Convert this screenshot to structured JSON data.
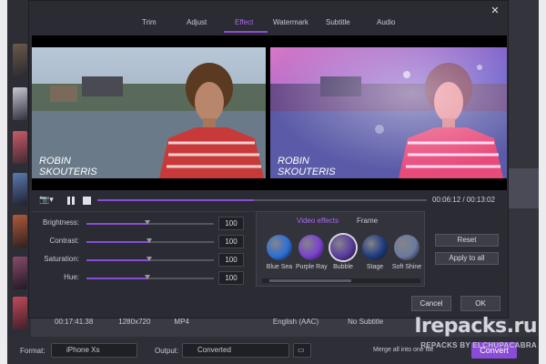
{
  "colors": {
    "accent": "#8a4cd6",
    "dialog_bg": "#2b2b33",
    "panel_bg": "#33333c"
  },
  "dialog": {
    "tabs": [
      {
        "label": "Trim"
      },
      {
        "label": "Adjust"
      },
      {
        "label": "Effect"
      },
      {
        "label": "Watermark"
      },
      {
        "label": "Subtitle"
      },
      {
        "label": "Audio"
      }
    ],
    "active_tab": "Effect",
    "close_icon": "close-icon"
  },
  "preview": {
    "left_caption": "ROBIN\nSKOUTERIS",
    "right_caption": "ROBIN\nSKOUTERIS"
  },
  "playback": {
    "timecode": "00:06:12 / 00:13:02",
    "progress": 0.476
  },
  "adjust": [
    {
      "label": "Brightness:",
      "value": "100",
      "level": 0.48
    },
    {
      "label": "Contrast:",
      "value": "100",
      "level": 0.49
    },
    {
      "label": "Saturation:",
      "value": "100",
      "level": 0.49
    },
    {
      "label": "Hue:",
      "value": "100",
      "level": 0.48
    }
  ],
  "effects_panel": {
    "tabs": [
      {
        "label": "Video effects"
      },
      {
        "label": "Frame"
      }
    ],
    "effects": [
      {
        "label": "Blue Sea",
        "color": "#2a6fd6"
      },
      {
        "label": "Purple Ray",
        "color": "#7a3fcf"
      },
      {
        "label": "Bubble",
        "color": "#5a3aa0"
      },
      {
        "label": "Stage",
        "color": "#1e3a80"
      },
      {
        "label": "Soft Shine",
        "color": "#6a7aa0"
      }
    ],
    "selected": "Bubble"
  },
  "right_buttons": {
    "reset": "Reset",
    "apply_all": "Apply to all"
  },
  "dialog_buttons": {
    "cancel": "Cancel",
    "ok": "OK"
  },
  "background": {
    "duration": "00:17:41.38",
    "resolution": "1280x720",
    "format": "MP4",
    "audio": "English (AAC)",
    "subtitle": "No Subtitle",
    "format_label": "Format:",
    "format_value": "iPhone Xs",
    "output_label": "Output:",
    "output_value": "Converted",
    "merge_label": "Merge all into one file",
    "convert": "Convert"
  },
  "watermark": {
    "main": "Irepacks.ru",
    "sub": "REPACKS BY ELCHUPACABRA"
  }
}
